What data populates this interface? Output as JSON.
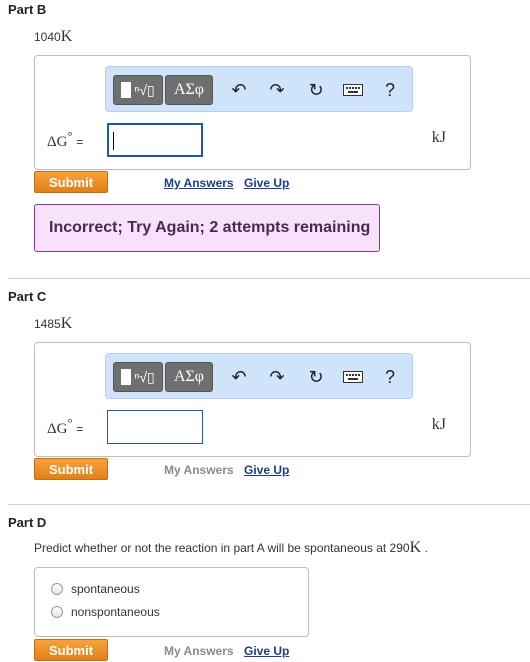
{
  "part_b": {
    "title": "Part B",
    "temperature_value": "1040",
    "temperature_unit": "K",
    "delta_g": "ΔG",
    "degree": "°",
    "equals": "=",
    "unit": "kJ",
    "submit_label": "Submit",
    "my_answers_label": "My Answers",
    "give_up_label": "Give Up",
    "feedback": "Incorrect; Try Again; 2 attempts remaining"
  },
  "part_c": {
    "title": "Part C",
    "temperature_value": "1485",
    "temperature_unit": "K",
    "delta_g": "ΔG",
    "degree": "°",
    "equals": "=",
    "unit": "kJ",
    "submit_label": "Submit",
    "my_answers_label": "My Answers",
    "give_up_label": "Give Up"
  },
  "part_d": {
    "title": "Part D",
    "prompt_text": "Predict whether or not the reaction in part A will be spontaneous at 290",
    "prompt_unit": "K",
    "prompt_end": " .",
    "options": [
      "spontaneous",
      "nonspontaneous"
    ],
    "submit_label": "Submit",
    "my_answers_label": "My Answers",
    "give_up_label": "Give Up"
  },
  "toolbar": {
    "templates_root": "ⁿ√▯",
    "symbols_label": "ΑΣφ",
    "undo_glyph": "↶",
    "redo_glyph": "↷",
    "reset_glyph": "↻",
    "help_glyph": "?",
    "icons": [
      "templates-icon",
      "symbols-icon",
      "undo-icon",
      "redo-icon",
      "reset-icon",
      "keyboard-icon",
      "help-icon"
    ]
  },
  "colors": {
    "submit": "#e8891f",
    "link": "#1c3c8c",
    "feedback_bg": "#f7e1fb",
    "feedback_border": "#8a3a93",
    "toolbar_bg": "#cfe3fb",
    "input_border": "#1e5aa8"
  }
}
